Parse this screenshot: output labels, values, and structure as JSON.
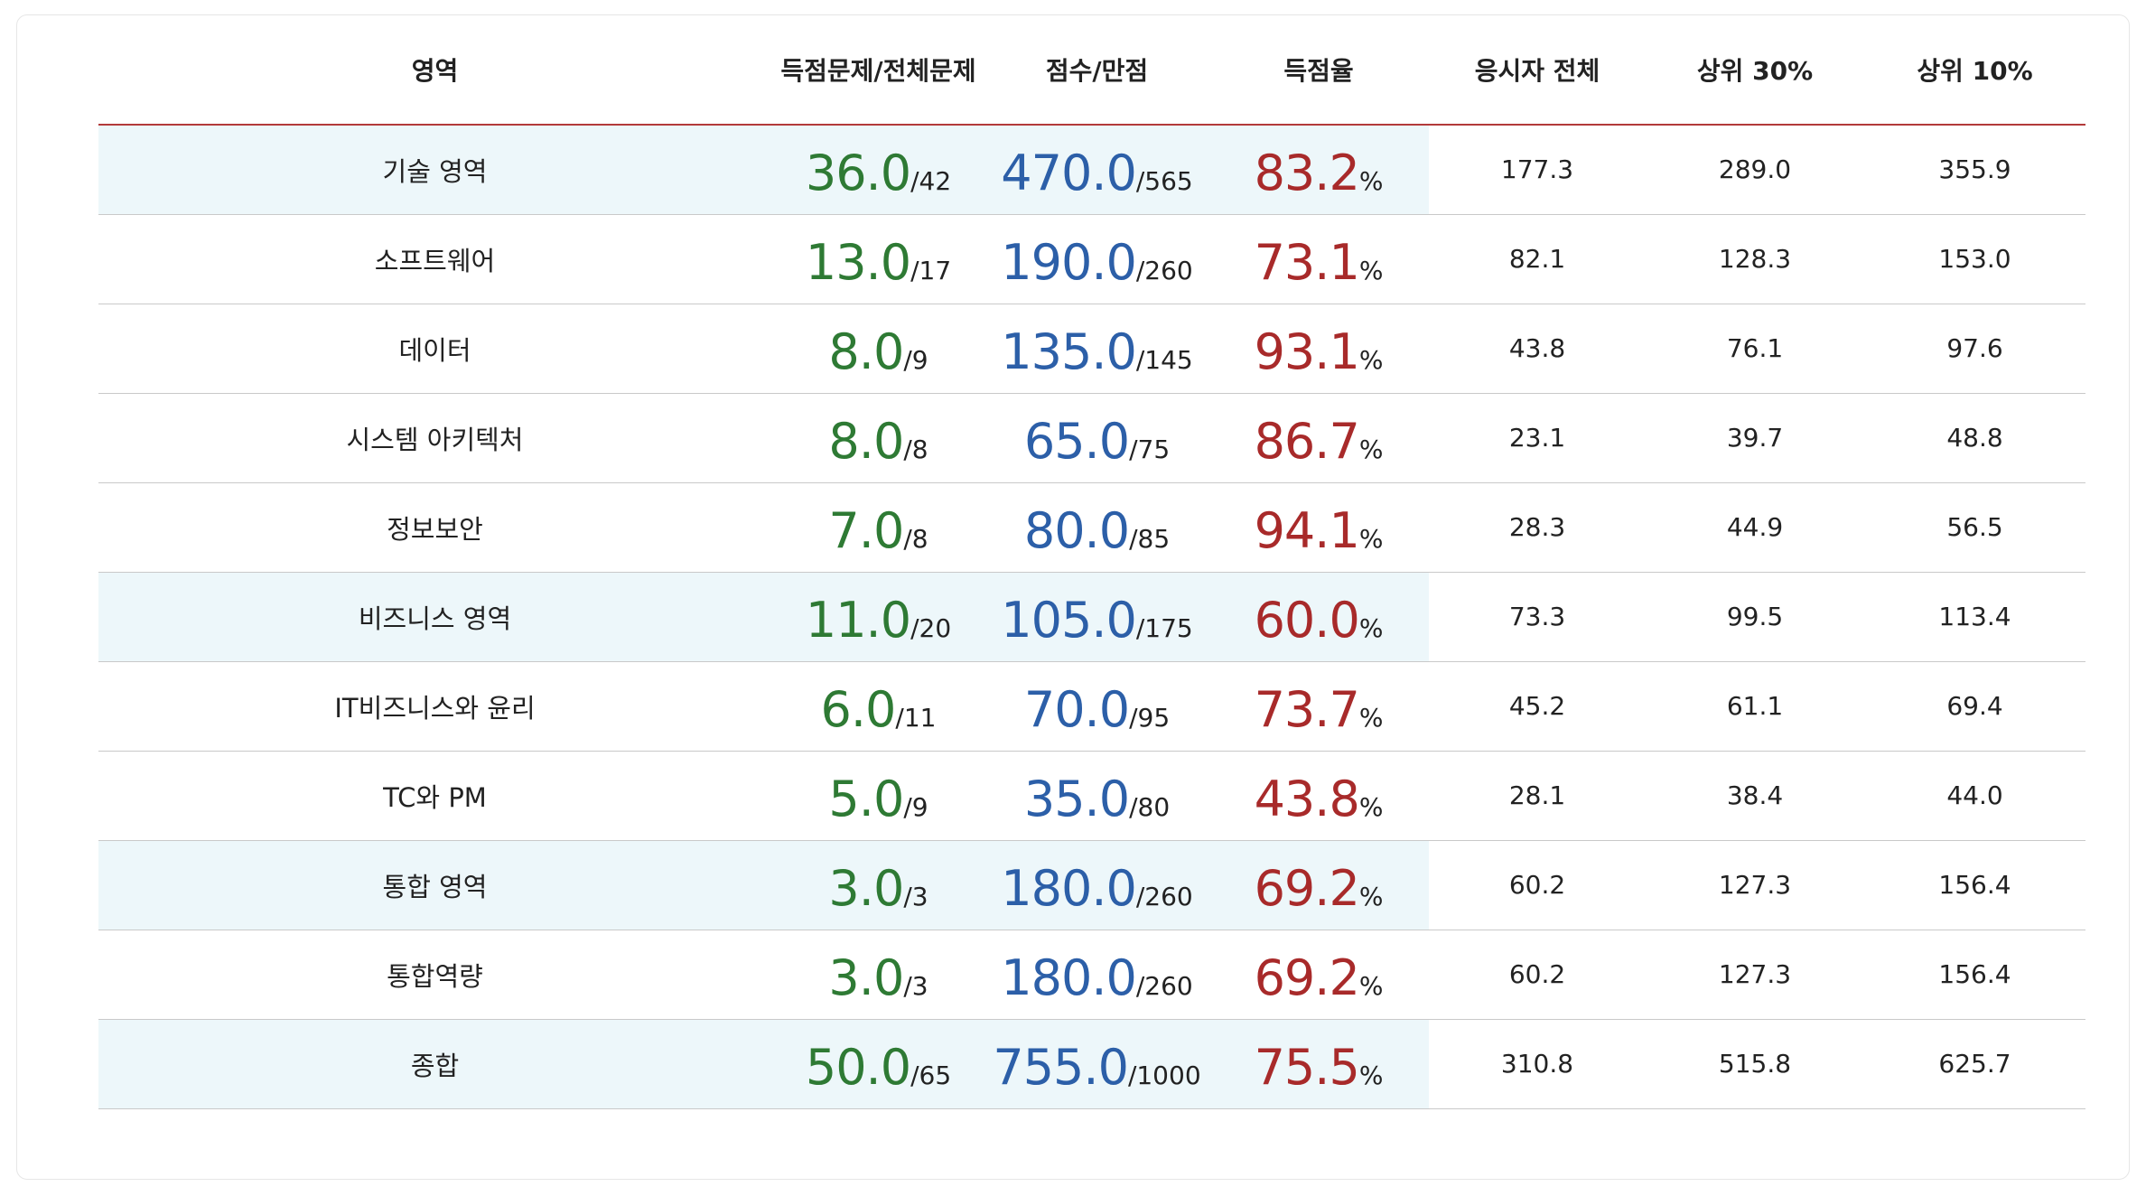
{
  "headers": {
    "area": "영역",
    "questions": "득점문제/전체문제",
    "score": "점수/만점",
    "rate": "득점율",
    "all": "응시자 전체",
    "top30": "상위 30%",
    "top10": "상위 10%"
  },
  "percent_sign": "%",
  "colors": {
    "questions": "#2e7a34",
    "score": "#2c5fa8",
    "rate": "#a82a2a",
    "header_rule": "#b33a3a",
    "summary_shade": "#edf7fa"
  },
  "rows": [
    {
      "area": "기술 영역",
      "summary": true,
      "correct": "36.0",
      "total": "/42",
      "score": "470.0",
      "max": "/565",
      "rate": "83.2",
      "all": "177.3",
      "top30": "289.0",
      "top10": "355.9"
    },
    {
      "area": "소프트웨어",
      "summary": false,
      "correct": "13.0",
      "total": "/17",
      "score": "190.0",
      "max": "/260",
      "rate": "73.1",
      "all": "82.1",
      "top30": "128.3",
      "top10": "153.0"
    },
    {
      "area": "데이터",
      "summary": false,
      "correct": "8.0",
      "total": "/9",
      "score": "135.0",
      "max": "/145",
      "rate": "93.1",
      "all": "43.8",
      "top30": "76.1",
      "top10": "97.6"
    },
    {
      "area": "시스템 아키텍처",
      "summary": false,
      "correct": "8.0",
      "total": "/8",
      "score": "65.0",
      "max": "/75",
      "rate": "86.7",
      "all": "23.1",
      "top30": "39.7",
      "top10": "48.8"
    },
    {
      "area": "정보보안",
      "summary": false,
      "correct": "7.0",
      "total": "/8",
      "score": "80.0",
      "max": "/85",
      "rate": "94.1",
      "all": "28.3",
      "top30": "44.9",
      "top10": "56.5"
    },
    {
      "area": "비즈니스 영역",
      "summary": true,
      "correct": "11.0",
      "total": "/20",
      "score": "105.0",
      "max": "/175",
      "rate": "60.0",
      "all": "73.3",
      "top30": "99.5",
      "top10": "113.4"
    },
    {
      "area": "IT비즈니스와 윤리",
      "summary": false,
      "correct": "6.0",
      "total": "/11",
      "score": "70.0",
      "max": "/95",
      "rate": "73.7",
      "all": "45.2",
      "top30": "61.1",
      "top10": "69.4"
    },
    {
      "area": "TC와 PM",
      "summary": false,
      "correct": "5.0",
      "total": "/9",
      "score": "35.0",
      "max": "/80",
      "rate": "43.8",
      "all": "28.1",
      "top30": "38.4",
      "top10": "44.0"
    },
    {
      "area": "통합 영역",
      "summary": true,
      "correct": "3.0",
      "total": "/3",
      "score": "180.0",
      "max": "/260",
      "rate": "69.2",
      "all": "60.2",
      "top30": "127.3",
      "top10": "156.4"
    },
    {
      "area": "통합역량",
      "summary": false,
      "correct": "3.0",
      "total": "/3",
      "score": "180.0",
      "max": "/260",
      "rate": "69.2",
      "all": "60.2",
      "top30": "127.3",
      "top10": "156.4"
    },
    {
      "area": "종합",
      "summary": true,
      "correct": "50.0",
      "total": "/65",
      "score": "755.0",
      "max": "/1000",
      "rate": "75.5",
      "all": "310.8",
      "top30": "515.8",
      "top10": "625.7"
    }
  ]
}
